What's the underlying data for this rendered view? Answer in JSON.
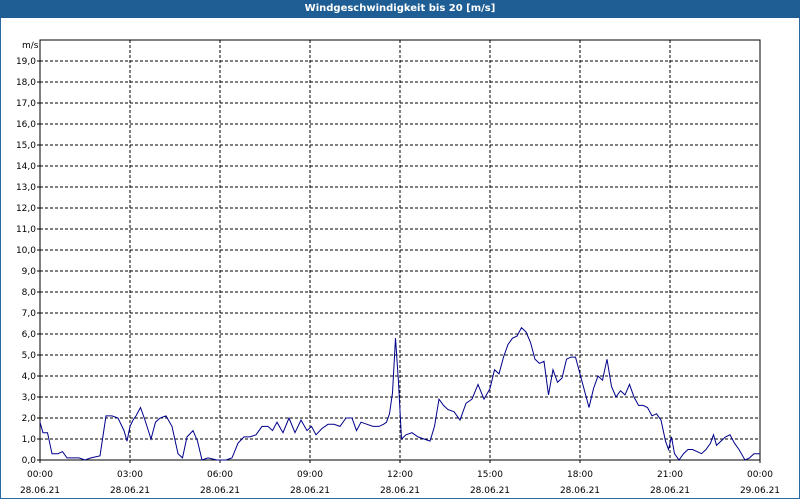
{
  "window": {
    "title": "Windgeschwindigkeit bis 20 [m/s]"
  },
  "colors": {
    "title_bar": "#1f5e95",
    "line": "#00008b",
    "grid": "#000000",
    "background": "#ffffff"
  },
  "chart_data": {
    "type": "line",
    "title": "Windgeschwindigkeit bis 20 [m/s]",
    "ylabel": "m/s",
    "xlabel": "",
    "ylim": [
      0,
      20
    ],
    "xlim_hours": [
      0,
      24
    ],
    "grid": true,
    "y_ticks": [
      "0,0",
      "1,0",
      "2,0",
      "3,0",
      "4,0",
      "5,0",
      "6,0",
      "7,0",
      "8,0",
      "9,0",
      "10,0",
      "11,0",
      "12,0",
      "13,0",
      "14,0",
      "15,0",
      "16,0",
      "17,0",
      "18,0",
      "19,0"
    ],
    "x_ticks": [
      {
        "time": "00:00",
        "date": "28.06.21"
      },
      {
        "time": "03:00",
        "date": "28.06.21"
      },
      {
        "time": "06:00",
        "date": "28.06.21"
      },
      {
        "time": "09:00",
        "date": "28.06.21"
      },
      {
        "time": "12:00",
        "date": "28.06.21"
      },
      {
        "time": "15:00",
        "date": "28.06.21"
      },
      {
        "time": "18:00",
        "date": "28.06.21"
      },
      {
        "time": "21:00",
        "date": "28.06.21"
      },
      {
        "time": "00:00",
        "date": "29.06.21"
      }
    ],
    "series": [
      {
        "values": [
          [
            0.0,
            1.8
          ],
          [
            0.1,
            1.3
          ],
          [
            0.25,
            1.3
          ],
          [
            0.4,
            0.3
          ],
          [
            0.6,
            0.3
          ],
          [
            0.75,
            0.4
          ],
          [
            0.9,
            0.1
          ],
          [
            1.1,
            0.1
          ],
          [
            1.3,
            0.1
          ],
          [
            1.5,
            0.0
          ],
          [
            1.7,
            0.1
          ],
          [
            2.0,
            0.2
          ],
          [
            2.2,
            2.1
          ],
          [
            2.4,
            2.1
          ],
          [
            2.6,
            2.0
          ],
          [
            2.8,
            1.4
          ],
          [
            2.9,
            0.9
          ],
          [
            3.0,
            1.6
          ],
          [
            3.1,
            1.9
          ],
          [
            3.2,
            2.1
          ],
          [
            3.35,
            2.5
          ],
          [
            3.5,
            1.9
          ],
          [
            3.7,
            1.0
          ],
          [
            3.85,
            1.8
          ],
          [
            4.0,
            2.0
          ],
          [
            4.2,
            2.1
          ],
          [
            4.4,
            1.6
          ],
          [
            4.6,
            0.3
          ],
          [
            4.75,
            0.1
          ],
          [
            4.9,
            1.1
          ],
          [
            5.1,
            1.4
          ],
          [
            5.25,
            0.9
          ],
          [
            5.4,
            0.0
          ],
          [
            5.6,
            0.1
          ],
          [
            5.9,
            0.0
          ],
          [
            6.0,
            0.0
          ],
          [
            6.2,
            0.0
          ],
          [
            6.4,
            0.1
          ],
          [
            6.6,
            0.8
          ],
          [
            6.8,
            1.1
          ],
          [
            7.0,
            1.1
          ],
          [
            7.2,
            1.2
          ],
          [
            7.4,
            1.6
          ],
          [
            7.6,
            1.6
          ],
          [
            7.75,
            1.4
          ],
          [
            7.9,
            1.8
          ],
          [
            8.1,
            1.3
          ],
          [
            8.3,
            2.0
          ],
          [
            8.5,
            1.3
          ],
          [
            8.7,
            1.9
          ],
          [
            8.9,
            1.4
          ],
          [
            9.05,
            1.6
          ],
          [
            9.2,
            1.2
          ],
          [
            9.4,
            1.5
          ],
          [
            9.6,
            1.7
          ],
          [
            9.8,
            1.7
          ],
          [
            10.0,
            1.6
          ],
          [
            10.2,
            2.0
          ],
          [
            10.4,
            2.0
          ],
          [
            10.55,
            1.4
          ],
          [
            10.7,
            1.8
          ],
          [
            10.9,
            1.7
          ],
          [
            11.1,
            1.6
          ],
          [
            11.3,
            1.6
          ],
          [
            11.45,
            1.7
          ],
          [
            11.55,
            1.8
          ],
          [
            11.65,
            2.2
          ],
          [
            11.75,
            3.2
          ],
          [
            11.85,
            5.8
          ],
          [
            11.95,
            3.7
          ],
          [
            12.05,
            1.0
          ],
          [
            12.2,
            1.2
          ],
          [
            12.4,
            1.3
          ],
          [
            12.6,
            1.1
          ],
          [
            12.8,
            1.0
          ],
          [
            13.0,
            0.9
          ],
          [
            13.15,
            1.6
          ],
          [
            13.3,
            2.9
          ],
          [
            13.45,
            2.6
          ],
          [
            13.6,
            2.4
          ],
          [
            13.8,
            2.3
          ],
          [
            14.0,
            1.9
          ],
          [
            14.2,
            2.7
          ],
          [
            14.4,
            2.9
          ],
          [
            14.6,
            3.6
          ],
          [
            14.8,
            2.9
          ],
          [
            15.0,
            3.4
          ],
          [
            15.15,
            4.3
          ],
          [
            15.3,
            4.1
          ],
          [
            15.45,
            4.9
          ],
          [
            15.6,
            5.5
          ],
          [
            15.75,
            5.8
          ],
          [
            15.9,
            5.9
          ],
          [
            16.05,
            6.3
          ],
          [
            16.2,
            6.1
          ],
          [
            16.35,
            5.6
          ],
          [
            16.5,
            4.8
          ],
          [
            16.65,
            4.6
          ],
          [
            16.8,
            4.7
          ],
          [
            16.95,
            3.1
          ],
          [
            17.1,
            4.3
          ],
          [
            17.25,
            3.7
          ],
          [
            17.4,
            3.9
          ],
          [
            17.55,
            4.8
          ],
          [
            17.7,
            4.9
          ],
          [
            17.85,
            4.9
          ],
          [
            18.0,
            4.1
          ],
          [
            18.15,
            3.3
          ],
          [
            18.3,
            2.5
          ],
          [
            18.45,
            3.4
          ],
          [
            18.6,
            4.0
          ],
          [
            18.75,
            3.8
          ],
          [
            18.9,
            4.8
          ],
          [
            19.05,
            3.5
          ],
          [
            19.2,
            3.0
          ],
          [
            19.35,
            3.3
          ],
          [
            19.5,
            3.1
          ],
          [
            19.65,
            3.6
          ],
          [
            19.8,
            3.0
          ],
          [
            19.95,
            2.6
          ],
          [
            20.1,
            2.6
          ],
          [
            20.25,
            2.5
          ],
          [
            20.4,
            2.1
          ],
          [
            20.55,
            2.2
          ],
          [
            20.7,
            1.9
          ],
          [
            20.85,
            0.9
          ],
          [
            20.95,
            0.5
          ],
          [
            21.05,
            1.1
          ],
          [
            21.15,
            0.3
          ],
          [
            21.3,
            0.0
          ],
          [
            21.45,
            0.3
          ],
          [
            21.6,
            0.5
          ],
          [
            21.75,
            0.5
          ],
          [
            21.9,
            0.4
          ],
          [
            22.05,
            0.3
          ],
          [
            22.2,
            0.5
          ],
          [
            22.35,
            0.8
          ],
          [
            22.45,
            1.2
          ],
          [
            22.55,
            0.7
          ],
          [
            22.7,
            0.9
          ],
          [
            22.85,
            1.1
          ],
          [
            23.0,
            1.2
          ],
          [
            23.15,
            0.8
          ],
          [
            23.3,
            0.5
          ],
          [
            23.5,
            0.0
          ],
          [
            23.65,
            0.1
          ],
          [
            23.8,
            0.3
          ],
          [
            24.0,
            0.3
          ]
        ]
      }
    ]
  }
}
